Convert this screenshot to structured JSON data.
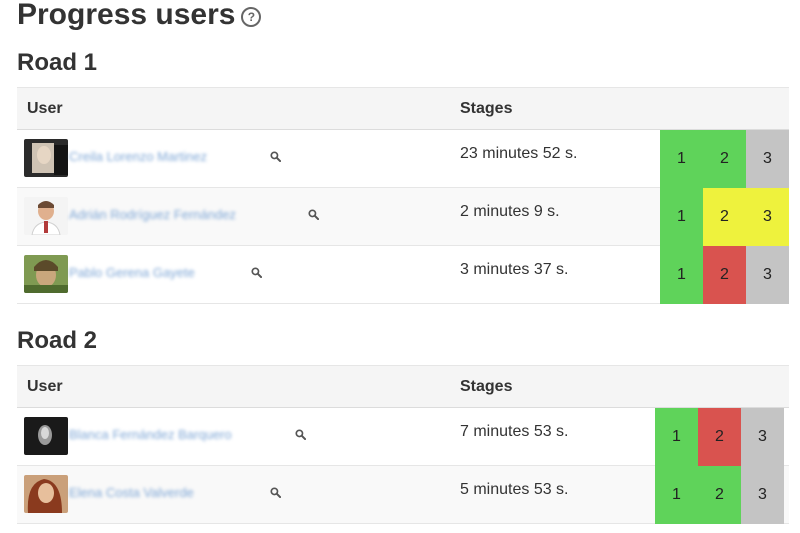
{
  "page": {
    "title": "Progress users",
    "help_icon": "question-circle-icon"
  },
  "colors": {
    "done": "#5fd35a",
    "current": "#eef23d",
    "failed": "#d9534f",
    "pending": "#c4c4c4",
    "link": "#7fa7d6"
  },
  "roads": [
    {
      "title": "Road 1",
      "headers": {
        "user": "User",
        "stages": "Stages"
      },
      "rows": [
        {
          "user": "Creila Lorenzo Martinez",
          "time": "23 minutes 52 s.",
          "stages": [
            {
              "label": "1",
              "status": "done"
            },
            {
              "label": "2",
              "status": "done"
            },
            {
              "label": "3",
              "status": "pending"
            }
          ]
        },
        {
          "user": "Adrián Rodríguez Fernández",
          "time": "2 minutes 9 s.",
          "stages": [
            {
              "label": "1",
              "status": "done"
            },
            {
              "label": "2",
              "status": "current"
            },
            {
              "label": "3",
              "status": "current"
            }
          ]
        },
        {
          "user": "Pablo Gerena Gayete",
          "time": "3 minutes 37 s.",
          "stages": [
            {
              "label": "1",
              "status": "done"
            },
            {
              "label": "2",
              "status": "failed"
            },
            {
              "label": "3",
              "status": "pending"
            }
          ]
        }
      ]
    },
    {
      "title": "Road 2",
      "headers": {
        "user": "User",
        "stages": "Stages"
      },
      "rows": [
        {
          "user": "Blanca Fernández Barquero",
          "time": "7 minutes 53 s.",
          "stages": [
            {
              "label": "1",
              "status": "done"
            },
            {
              "label": "2",
              "status": "failed"
            },
            {
              "label": "3",
              "status": "pending"
            }
          ]
        },
        {
          "user": "Elena Costa Valverde",
          "time": "5 minutes 53 s.",
          "stages": [
            {
              "label": "1",
              "status": "done"
            },
            {
              "label": "2",
              "status": "done"
            },
            {
              "label": "3",
              "status": "pending"
            }
          ]
        }
      ]
    }
  ]
}
